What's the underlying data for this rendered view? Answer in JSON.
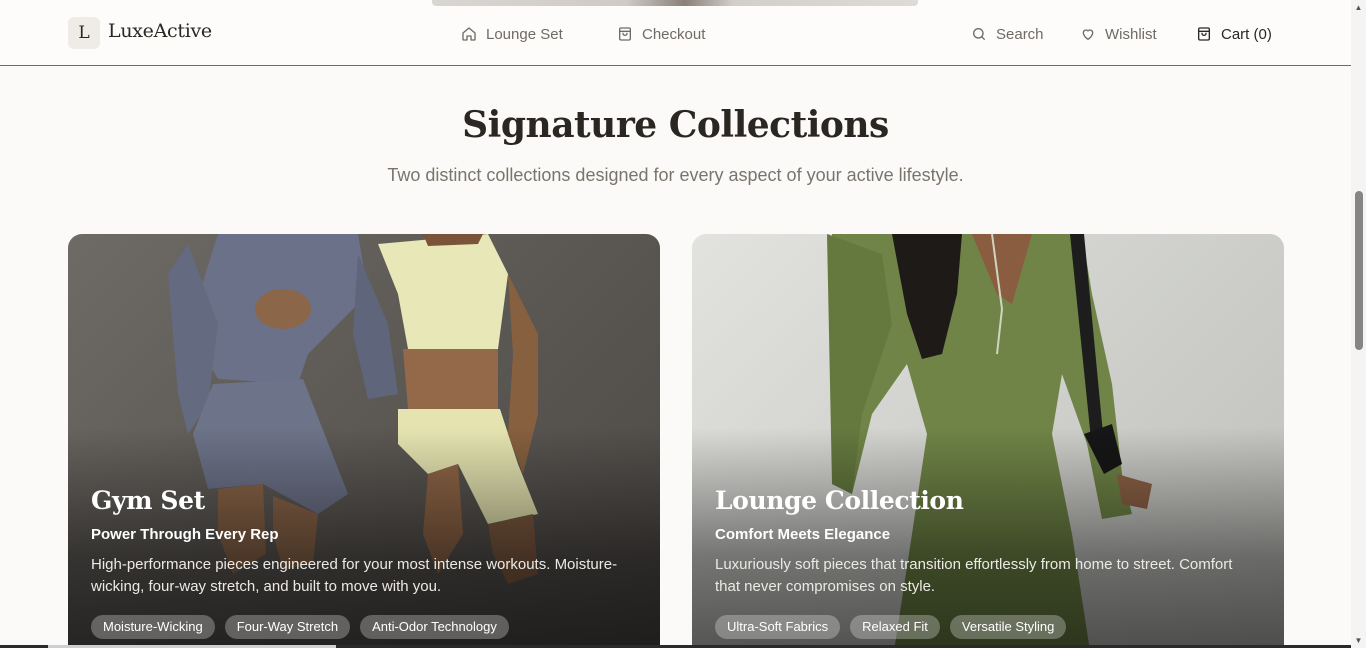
{
  "brand": {
    "logo_letter": "L",
    "name": "LuxeActive"
  },
  "nav": {
    "lounge_set": "Lounge Set",
    "checkout": "Checkout",
    "search": "Search",
    "wishlist": "Wishlist",
    "cart": "Cart (0)"
  },
  "section": {
    "title": "Signature Collections",
    "subtitle": "Two distinct collections designed for every aspect of your active lifestyle."
  },
  "cards": [
    {
      "title": "Gym Set",
      "tagline": "Power Through Every Rep",
      "description": "High-performance pieces engineered for your most intense workouts. Moisture-wicking, four-way stretch, and built to move with you.",
      "tags": [
        "Moisture-Wicking",
        "Four-Way Stretch",
        "Anti-Odor Technology"
      ]
    },
    {
      "title": "Lounge Collection",
      "tagline": "Comfort Meets Elegance",
      "description": "Luxuriously soft pieces that transition effortlessly from home to street. Comfort that never compromises on style.",
      "tags": [
        "Ultra-Soft Fabrics",
        "Relaxed Fit",
        "Versatile Styling"
      ]
    }
  ],
  "icons": {
    "lounge_set": "home-icon",
    "checkout": "shopping-bag-icon",
    "search": "search-icon",
    "wishlist": "heart-icon",
    "cart": "shopping-bag-icon"
  },
  "colors": {
    "background": "#fbfaf8",
    "text_dark": "#2a2622",
    "text_muted": "#7a746e"
  }
}
